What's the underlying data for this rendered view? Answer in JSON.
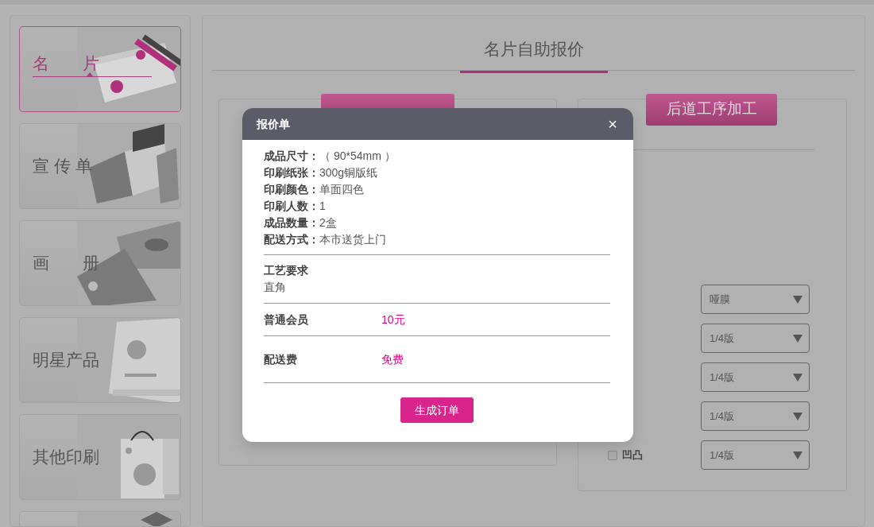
{
  "sidebar": {
    "cards": [
      {
        "label": "名　　片",
        "selected": true
      },
      {
        "label": "宣 传 单",
        "selected": false
      },
      {
        "label": "画　　册",
        "selected": false
      },
      {
        "label": "明星产品",
        "selected": false
      },
      {
        "label": "其他印刷",
        "selected": false
      },
      {
        "selected": false
      }
    ]
  },
  "main": {
    "title": "名片自助报价",
    "right_panel": {
      "ribbon": "后道工序加工",
      "options": [
        {
          "select": "哑膜"
        },
        {
          "select": "1/4版"
        },
        {
          "select": "1/4版"
        },
        {
          "select": "1/4版"
        },
        {
          "label": "凹凸",
          "checked": false,
          "select": "1/4版"
        }
      ]
    }
  },
  "modal": {
    "title": "报价单",
    "close": "×",
    "specs": [
      {
        "label": "成品尺寸：",
        "value": "（ 90*54mm ）"
      },
      {
        "label": "印刷纸张：",
        "value": "300g铜版纸"
      },
      {
        "label": "印刷颜色：",
        "value": "单面四色"
      },
      {
        "label": "印刷人数：",
        "value": "1"
      },
      {
        "label": "成品数量：",
        "value": "2盒"
      },
      {
        "label": "配送方式：",
        "value": "本市送货上门"
      }
    ],
    "craft": {
      "heading": "工艺要求",
      "value": "直角"
    },
    "prices": [
      {
        "label": "普通会员",
        "value": "10元"
      },
      {
        "label": "配送费",
        "value": "免费"
      }
    ],
    "button": "生成订单"
  }
}
